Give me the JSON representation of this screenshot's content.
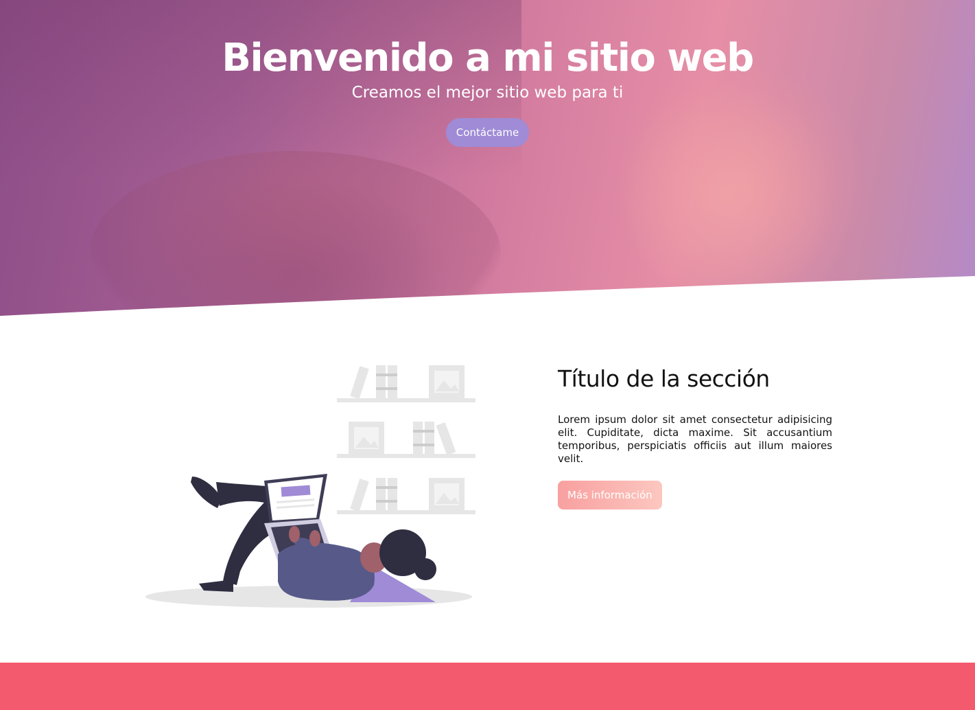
{
  "hero": {
    "title": "Bienvenido a mi sitio web",
    "subtitle": "Creamos el mejor sitio web para ti",
    "cta_label": "Contáctame"
  },
  "section": {
    "title": "Título de la sección",
    "body": "Lorem ipsum dolor sit amet consectetur adipisicing elit. Cupiditate, dicta maxime. Sit accusantium temporibus, perspiciatis officiis aut illum maiores velit.",
    "button_label": "Más información"
  },
  "colors": {
    "hero_overlay": "#c06f9f",
    "cta_button": "#9f8bd6",
    "info_button": "#f8a0a0",
    "footer_band": "#f45a6e"
  }
}
